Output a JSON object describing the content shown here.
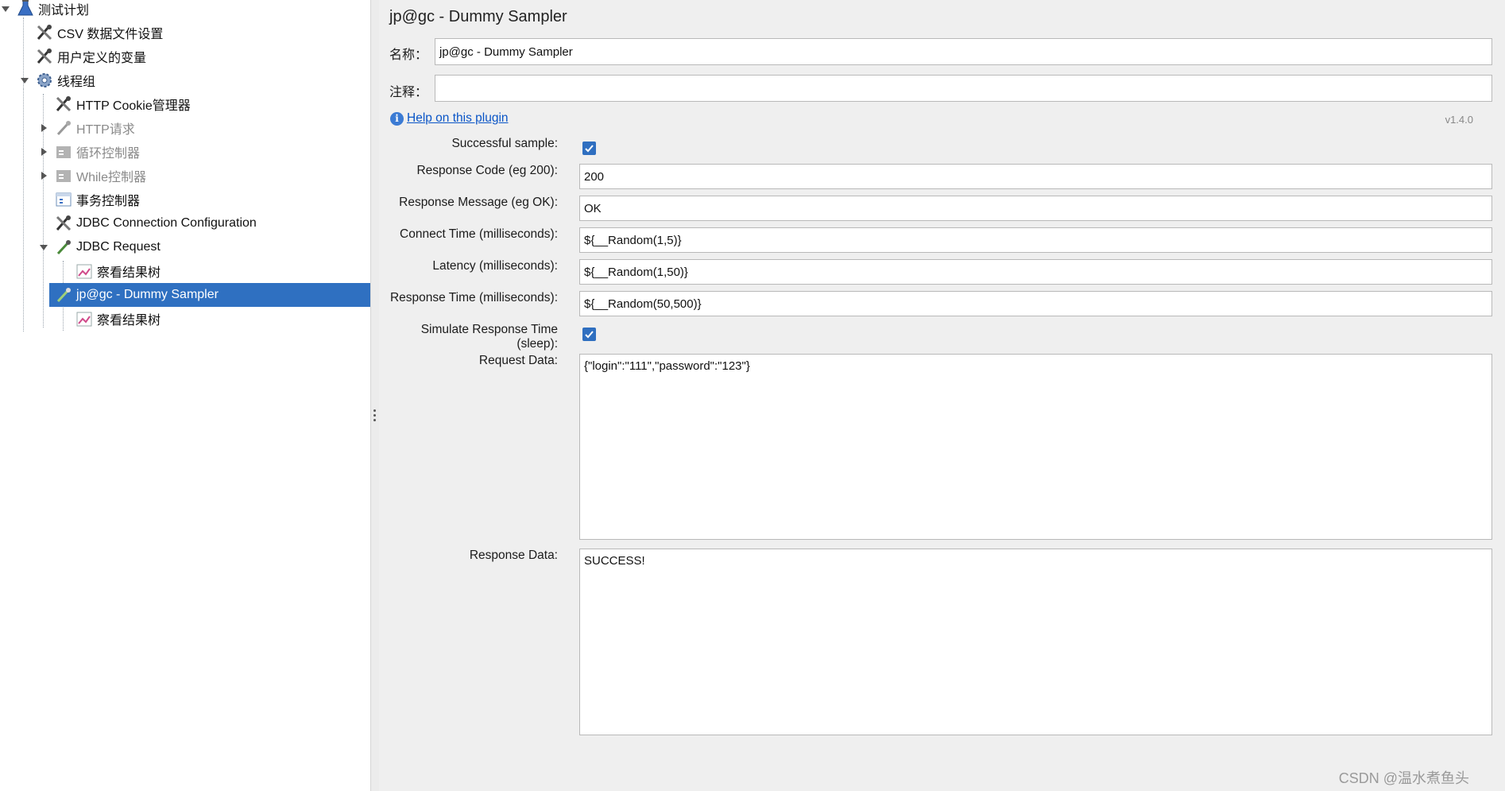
{
  "tree": {
    "items": [
      {
        "label": "测试计划"
      },
      {
        "label": "CSV 数据文件设置"
      },
      {
        "label": "用户定义的变量"
      },
      {
        "label": "线程组"
      },
      {
        "label": "HTTP Cookie管理器"
      },
      {
        "label": "HTTP请求"
      },
      {
        "label": "循环控制器"
      },
      {
        "label": "While控制器"
      },
      {
        "label": "事务控制器"
      },
      {
        "label": "JDBC Connection Configuration"
      },
      {
        "label": "JDBC Request"
      },
      {
        "label": "察看结果树"
      },
      {
        "label": "jp@gc - Dummy Sampler"
      },
      {
        "label": "察看结果树"
      }
    ]
  },
  "panel": {
    "title": "jp@gc - Dummy Sampler",
    "name_label": "名称：",
    "name_value": "jp@gc - Dummy Sampler",
    "comment_label": "注释：",
    "comment_value": "",
    "help_link": "Help on this plugin",
    "version": "v1.4.0",
    "fields": {
      "successful_sample": {
        "label": "Successful sample:",
        "checked": true
      },
      "response_code": {
        "label": "Response Code (eg 200):",
        "value": "200"
      },
      "response_message": {
        "label": "Response Message (eg OK):",
        "value": "OK"
      },
      "connect_time": {
        "label": "Connect Time (milliseconds):",
        "value": "${__Random(1,5)}"
      },
      "latency": {
        "label": "Latency (milliseconds):",
        "value": "${__Random(1,50)}"
      },
      "response_time": {
        "label": "Response Time (milliseconds):",
        "value": "${__Random(50,500)}"
      },
      "simulate_sleep": {
        "label": "Simulate Response Time (sleep):",
        "checked": true
      },
      "request_data": {
        "label": "Request Data:",
        "value": "{\"login\":\"111\",\"password\":\"123\"}"
      },
      "response_data": {
        "label": "Response Data:",
        "value": "SUCCESS!"
      }
    }
  },
  "watermark": "CSDN @温水煮鱼头",
  "colors": {
    "selection": "#2f70c1",
    "link": "#0a55c7",
    "checkbox": "#2f6fc0"
  }
}
